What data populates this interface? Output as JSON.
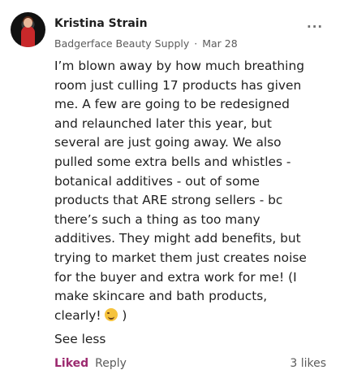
{
  "post": {
    "author_name": "Kristina Strain",
    "group_name": "Badgerface Beauty Supply",
    "separator": "·",
    "date": "Mar 28",
    "more_icon": "...",
    "body_text": "I’m blown away by how much breathing room just culling 17 products has given me. A few are going to be redesigned and relaunched later this year, but several are just going away. We also pulled some extra bells and whistles - botanical additives - out of some products that ARE strong sellers - bc there’s such a thing as too many additives. They might add benefits, but trying to market them just creates noise for the buyer and extra work for me! (I make skincare and bath products, clearly!",
    "body_end": ")",
    "emoji_icon": "smiling-face-icon",
    "see_less_label": "See less"
  },
  "actions": {
    "liked_label": "Liked",
    "reply_label": "Reply",
    "likes_count": "3 likes"
  },
  "colors": {
    "liked_accent": "#9c2a6f",
    "muted_text": "#5b5b5b"
  }
}
